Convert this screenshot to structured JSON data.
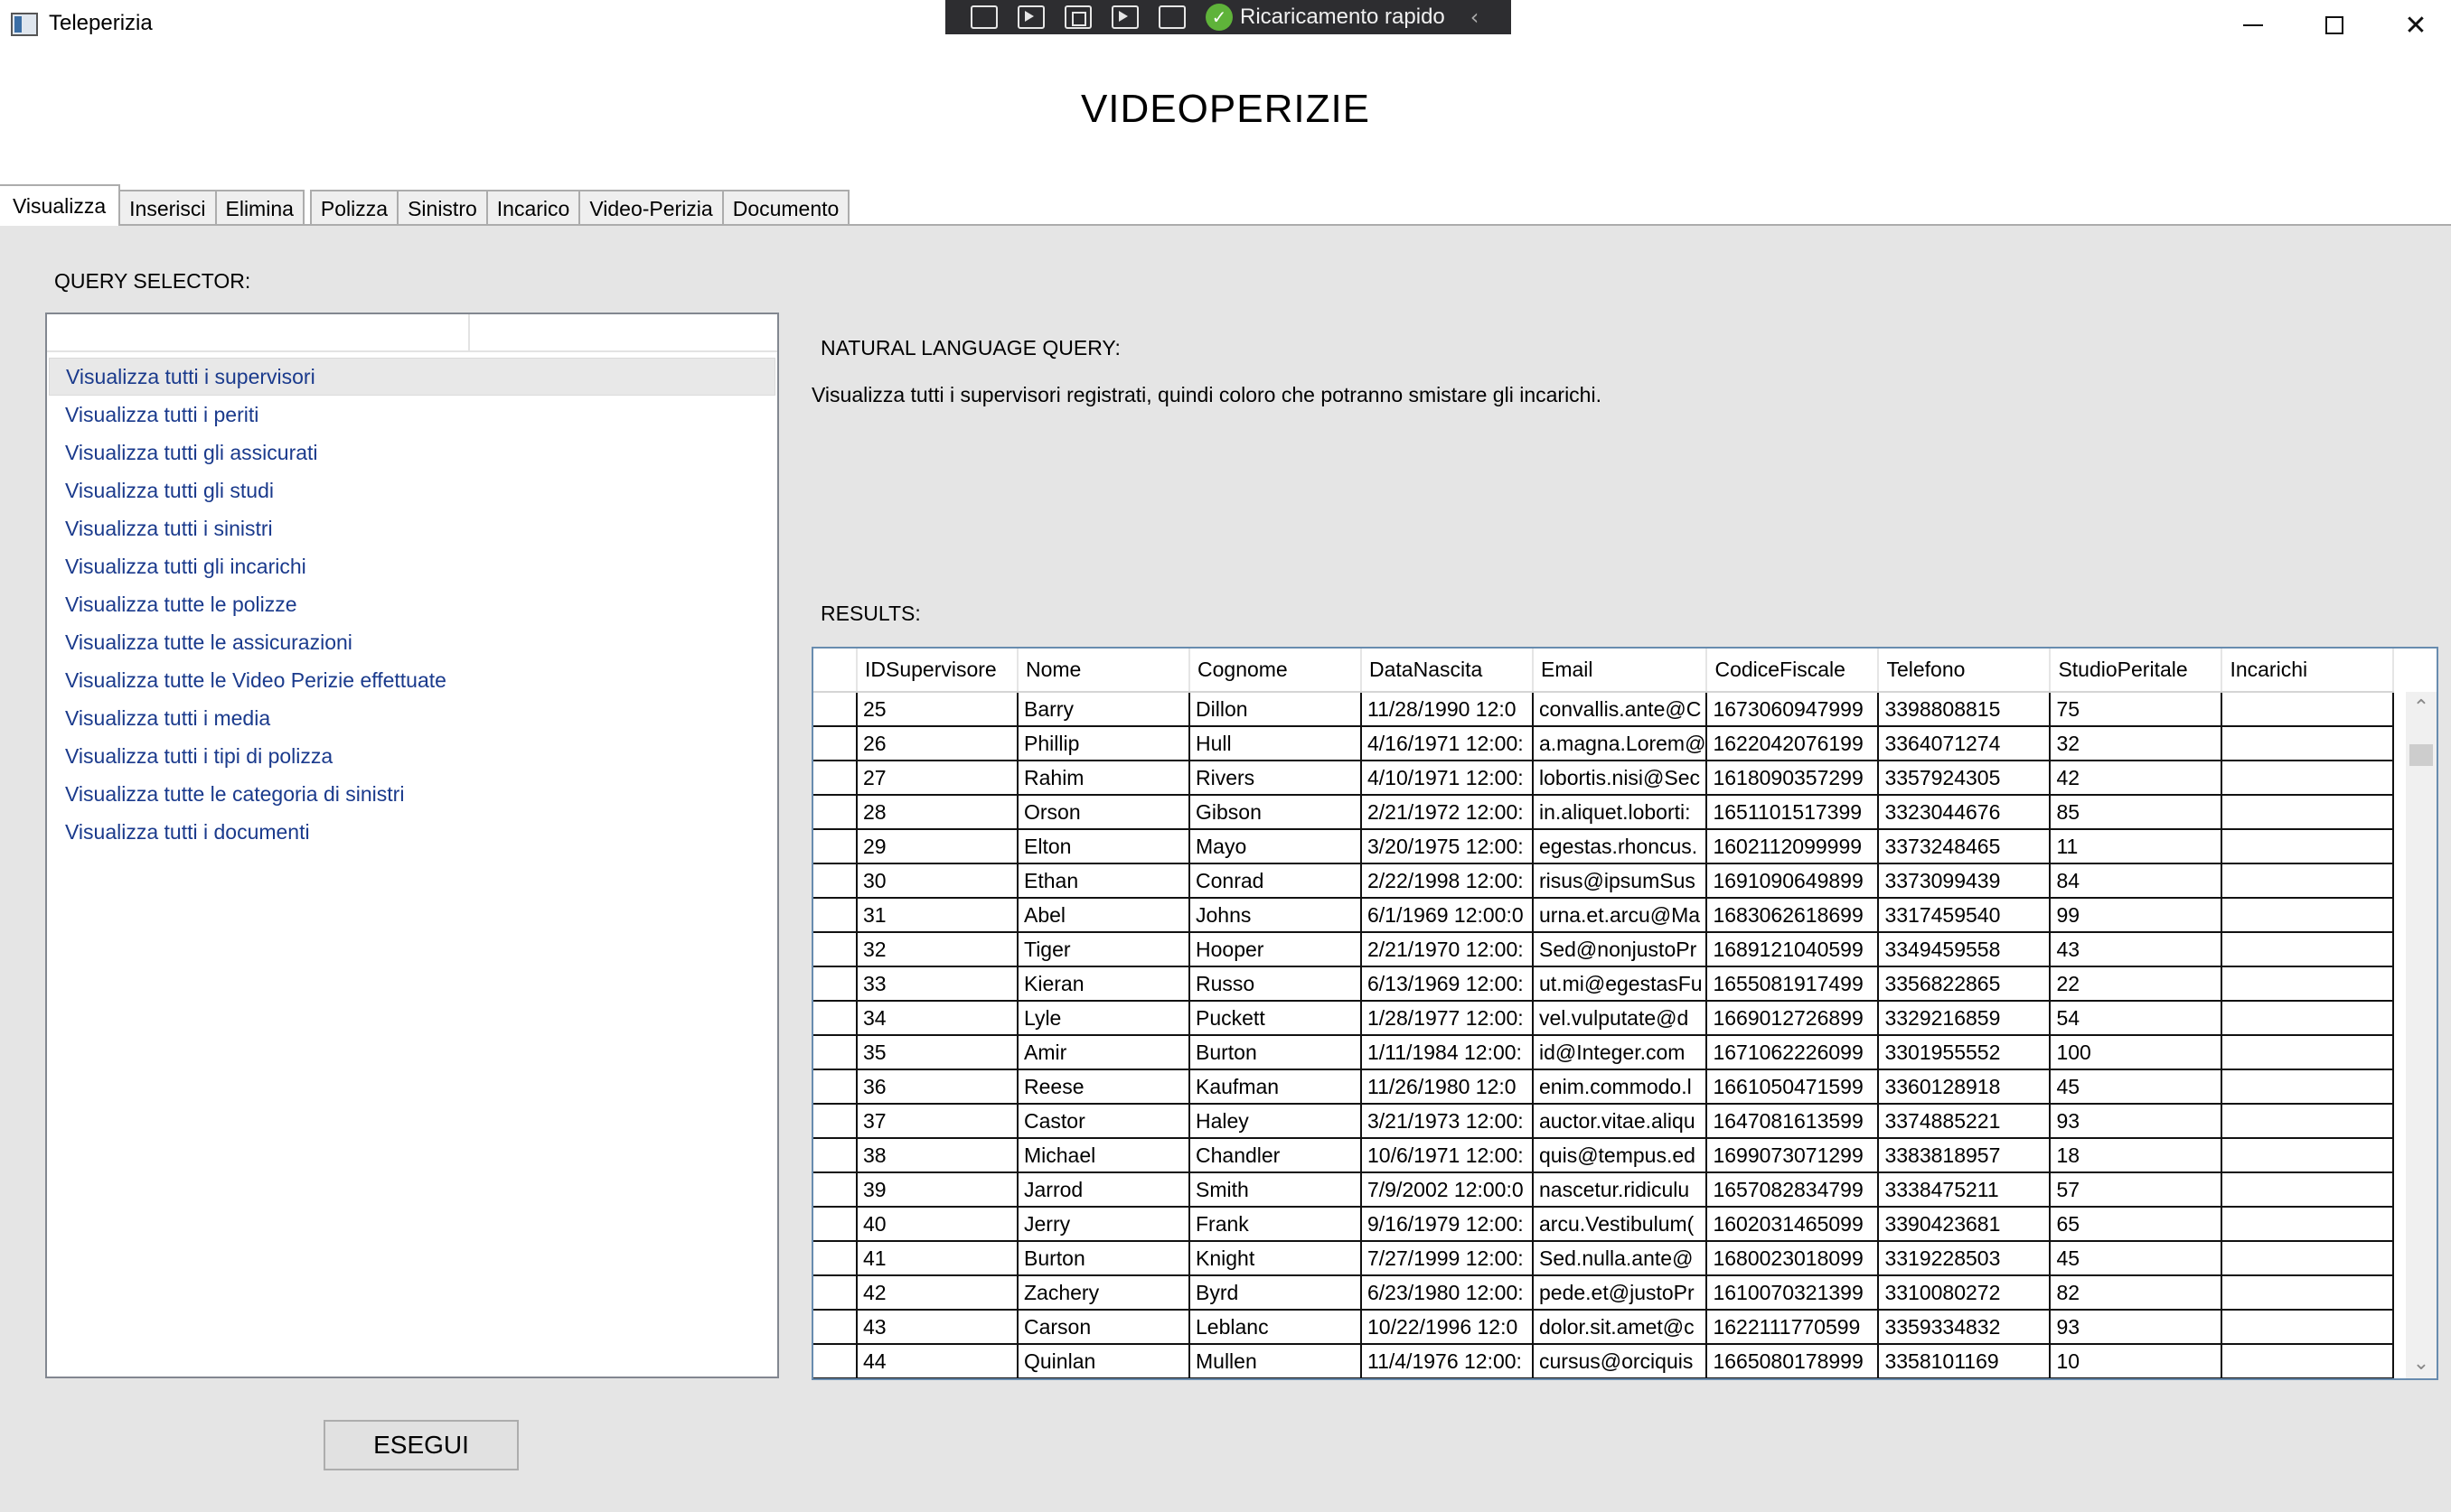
{
  "window": {
    "title": "Teleperizia",
    "hot_reload_label": "Ricaricamento rapido",
    "min_glyph": "",
    "close_glyph": "✕"
  },
  "header": {
    "title": "VIDEOPERIZIE"
  },
  "tabs": [
    {
      "label": "Visualizza",
      "active": true
    },
    {
      "label": "Inserisci"
    },
    {
      "label": "Elimina"
    },
    {
      "label": "Polizza"
    },
    {
      "label": "Sinistro"
    },
    {
      "label": "Incarico"
    },
    {
      "label": "Video-Perizia"
    },
    {
      "label": "Documento"
    }
  ],
  "query_selector": {
    "label": "QUERY SELECTOR:",
    "items": [
      "Visualizza tutti i supervisori",
      "Visualizza tutti i periti",
      "Visualizza tutti gli assicurati",
      "Visualizza tutti gli studi",
      "Visualizza tutti i sinistri",
      "Visualizza tutti gli incarichi",
      "Visualizza tutte le polizze",
      "Visualizza tutte le assicurazioni",
      "Visualizza tutte le Video Perizie effettuate",
      "Visualizza tutti i media",
      "Visualizza tutti i tipi di polizza",
      "Visualizza tutte le categoria di sinistri",
      "Visualizza tutti i documenti"
    ],
    "selected_index": 0
  },
  "natural_language": {
    "label": "NATURAL LANGUAGE QUERY:",
    "text": "Visualizza tutti i supervisori registrati, quindi coloro che potranno smistare gli incarichi."
  },
  "results": {
    "label": "RESULTS:",
    "columns": [
      "IDSupervisore",
      "Nome",
      "Cognome",
      "DataNascita",
      "Email",
      "CodiceFiscale",
      "Telefono",
      "StudioPeritale",
      "Incarichi"
    ],
    "rows": [
      [
        "25",
        "Barry",
        "Dillon",
        "11/28/1990 12:0",
        "convallis.ante@C",
        "1673060947999",
        "3398808815",
        "75",
        ""
      ],
      [
        "26",
        "Phillip",
        "Hull",
        "4/16/1971 12:00:",
        "a.magna.Lorem@",
        "1622042076199",
        "3364071274",
        "32",
        ""
      ],
      [
        "27",
        "Rahim",
        "Rivers",
        "4/10/1971 12:00:",
        "lobortis.nisi@Sec",
        "1618090357299",
        "3357924305",
        "42",
        ""
      ],
      [
        "28",
        "Orson",
        "Gibson",
        "2/21/1972 12:00:",
        "in.aliquet.loborti:",
        "1651101517399",
        "3323044676",
        "85",
        ""
      ],
      [
        "29",
        "Elton",
        "Mayo",
        "3/20/1975 12:00:",
        "egestas.rhoncus.",
        "1602112099999",
        "3373248465",
        "11",
        ""
      ],
      [
        "30",
        "Ethan",
        "Conrad",
        "2/22/1998 12:00:",
        "risus@ipsumSus",
        "1691090649899",
        "3373099439",
        "84",
        ""
      ],
      [
        "31",
        "Abel",
        "Johns",
        "6/1/1969 12:00:0",
        "urna.et.arcu@Ma",
        "1683062618699",
        "3317459540",
        "99",
        ""
      ],
      [
        "32",
        "Tiger",
        "Hooper",
        "2/21/1970 12:00:",
        "Sed@nonjustoPr",
        "1689121040599",
        "3349459558",
        "43",
        ""
      ],
      [
        "33",
        "Kieran",
        "Russo",
        "6/13/1969 12:00:",
        "ut.mi@egestasFu",
        "1655081917499",
        "3356822865",
        "22",
        ""
      ],
      [
        "34",
        "Lyle",
        "Puckett",
        "1/28/1977 12:00:",
        "vel.vulputate@d",
        "1669012726899",
        "3329216859",
        "54",
        ""
      ],
      [
        "35",
        "Amir",
        "Burton",
        "1/11/1984 12:00:",
        "id@Integer.com",
        "1671062226099",
        "3301955552",
        "100",
        ""
      ],
      [
        "36",
        "Reese",
        "Kaufman",
        "11/26/1980 12:0",
        "enim.commodo.l",
        "1661050471599",
        "3360128918",
        "45",
        ""
      ],
      [
        "37",
        "Castor",
        "Haley",
        "3/21/1973 12:00:",
        "auctor.vitae.aliqu",
        "1647081613599",
        "3374885221",
        "93",
        ""
      ],
      [
        "38",
        "Michael",
        "Chandler",
        "10/6/1971 12:00:",
        "quis@tempus.ed",
        "1699073071299",
        "3383818957",
        "18",
        ""
      ],
      [
        "39",
        "Jarrod",
        "Smith",
        "7/9/2002 12:00:0",
        "nascetur.ridiculu",
        "1657082834799",
        "3338475211",
        "57",
        ""
      ],
      [
        "40",
        "Jerry",
        "Frank",
        "9/16/1979 12:00:",
        "arcu.Vestibulum(",
        "1602031465099",
        "3390423681",
        "65",
        ""
      ],
      [
        "41",
        "Burton",
        "Knight",
        "7/27/1999 12:00:",
        "Sed.nulla.ante@",
        "1680023018099",
        "3319228503",
        "45",
        ""
      ],
      [
        "42",
        "Zachery",
        "Byrd",
        "6/23/1980 12:00:",
        "pede.et@justoPr",
        "1610070321399",
        "3310080272",
        "82",
        ""
      ],
      [
        "43",
        "Carson",
        "Leblanc",
        "10/22/1996 12:0",
        "dolor.sit.amet@c",
        "1622111770599",
        "3359334832",
        "93",
        ""
      ],
      [
        "44",
        "Quinlan",
        "Mullen",
        "11/4/1976 12:00:",
        "cursus@orciquis",
        "1665080178999",
        "3358101169",
        "10",
        ""
      ]
    ]
  },
  "actions": {
    "run_label": "ESEGUI"
  },
  "colors": {
    "panel_bg": "#e5e5e5",
    "link_text": "#1a3a8c",
    "grid_border": "#688caf",
    "toolbar_bg": "#2d2d30",
    "hot_reload_ok": "#5fb33a"
  }
}
